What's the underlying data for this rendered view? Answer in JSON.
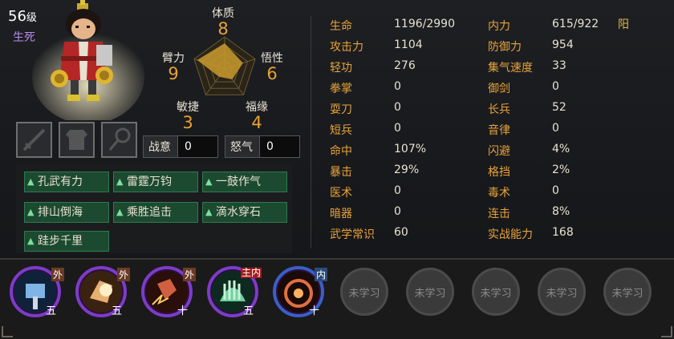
{
  "character": {
    "level": "56",
    "level_unit": "级",
    "title": "生死"
  },
  "equipment_slots": [
    {
      "icon": "sword-icon"
    },
    {
      "icon": "armor-icon"
    },
    {
      "icon": "accessory-icon"
    }
  ],
  "radar": {
    "stats": [
      {
        "label": "体质",
        "value": "8"
      },
      {
        "label": "悟性",
        "value": "6"
      },
      {
        "label": "福缘",
        "value": "4"
      },
      {
        "label": "敏捷",
        "value": "3"
      },
      {
        "label": "臂力",
        "value": "9"
      }
    ],
    "max": 10,
    "fill_color": "#c99a2e"
  },
  "gauges": {
    "zhanyi_label": "战意",
    "zhanyi_value": "0",
    "nuqi_label": "怒气",
    "nuqi_value": "0"
  },
  "traits": [
    "孔武有力",
    "雷霆万钧",
    "一鼓作气",
    "排山倒海",
    "乘胜追击",
    "滴水穿石",
    "跬步千里"
  ],
  "attributes_left": [
    {
      "label": "生命",
      "value": "1196/2990"
    },
    {
      "label": "攻击力",
      "value": "1104"
    },
    {
      "label": "轻功",
      "value": "276"
    },
    {
      "label": "拳掌",
      "value": "0"
    },
    {
      "label": "耍刀",
      "value": "0"
    },
    {
      "label": "短兵",
      "value": "0"
    },
    {
      "label": "命中",
      "value": "107%"
    },
    {
      "label": "暴击",
      "value": "29%"
    },
    {
      "label": "医术",
      "value": "0"
    },
    {
      "label": "暗器",
      "value": "0"
    },
    {
      "label": "武学常识",
      "value": "60"
    }
  ],
  "attributes_right": [
    {
      "label": "内力",
      "value": "615/922"
    },
    {
      "label": "防御力",
      "value": "954"
    },
    {
      "label": "集气速度",
      "value": "33"
    },
    {
      "label": "御剑",
      "value": "0"
    },
    {
      "label": "长兵",
      "value": "52"
    },
    {
      "label": "音律",
      "value": "0"
    },
    {
      "label": "闪避",
      "value": "4%"
    },
    {
      "label": "格挡",
      "value": "2%"
    },
    {
      "label": "毒术",
      "value": "0"
    },
    {
      "label": "连击",
      "value": "8%"
    },
    {
      "label": "实战能力",
      "value": "168"
    }
  ],
  "alignment": "阳",
  "skills": [
    {
      "icon": "hammer-strike-icon",
      "type": "外",
      "level": "五",
      "color": "#5aa0e0"
    },
    {
      "icon": "fist-strike-icon",
      "type": "外",
      "level": "五",
      "color": "#e0a050"
    },
    {
      "icon": "lightning-fist-icon",
      "type": "外",
      "level": "十",
      "color": "#d05030"
    },
    {
      "icon": "green-palm-icon",
      "type": "主内",
      "level": "五",
      "color": "#60c090"
    },
    {
      "icon": "fire-ring-icon",
      "type": "内",
      "level": "十",
      "color": "#e06040"
    }
  ],
  "locked_skills": [
    "未学习",
    "未学习",
    "未学习",
    "未学习",
    "未学习"
  ]
}
